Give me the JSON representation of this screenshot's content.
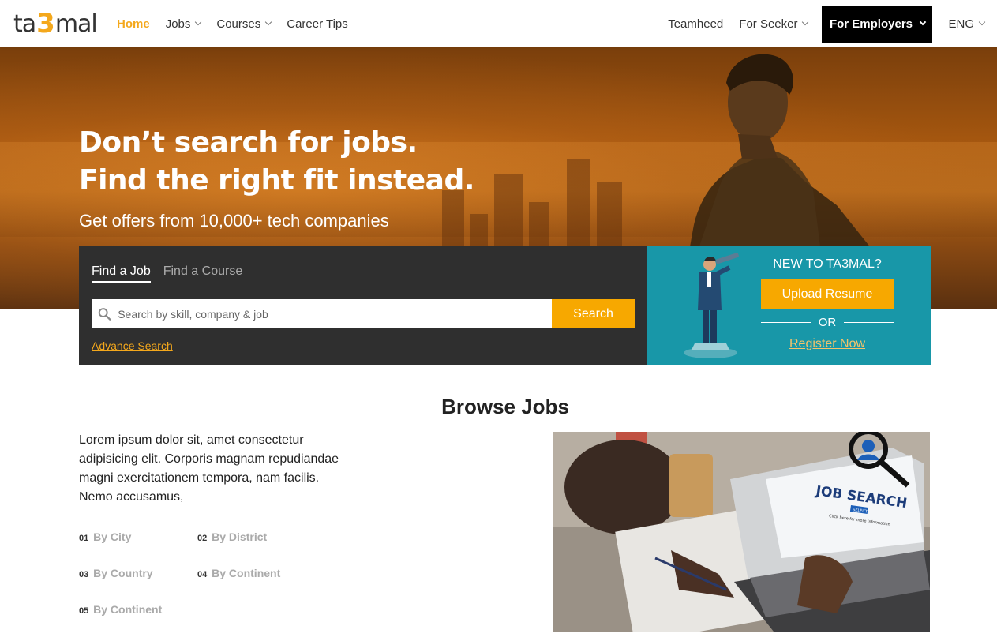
{
  "logo": {
    "left": "ta",
    "mid": "3",
    "right": "mal"
  },
  "nav": {
    "home": "Home",
    "jobs": "Jobs",
    "courses": "Courses",
    "career_tips": "Career Tips",
    "teamheed": "Teamheed",
    "for_seeker": "For Seeker",
    "for_employers": "For Employers",
    "lang": "ENG"
  },
  "hero": {
    "headline_1": "Don’t search for jobs.",
    "headline_2": "Find the right fit instead.",
    "subtitle": "Get offers from 10,000+ tech companies"
  },
  "search": {
    "tab_job": "Find a Job",
    "tab_course": "Find a Course",
    "placeholder": "Search by skill, company & job",
    "button": "Search",
    "advance": "Advance Search"
  },
  "signup": {
    "title": "NEW TO TA3MAL?",
    "upload": "Upload Resume",
    "or": "OR",
    "register": "Register Now"
  },
  "browse": {
    "title": "Browse Jobs",
    "description": "Lorem ipsum dolor sit, amet consectetur adipisicing elit. Corporis magnam repudiandae magni exercitationem tempora, nam facilis. Nemo accusamus,",
    "categories": [
      {
        "num": "01",
        "label": "By City"
      },
      {
        "num": "02",
        "label": "By District"
      },
      {
        "num": "03",
        "label": "By Country"
      },
      {
        "num": "04",
        "label": "By Continent"
      },
      {
        "num": "05",
        "label": "By Continent"
      }
    ],
    "photo_text_1": "JOB SEARCH",
    "photo_text_2": "SELECT",
    "photo_text_3": "Click here for more information"
  },
  "colors": {
    "accent": "#f7a800",
    "dark_panel": "#2f2f2f",
    "teal_panel": "#1897a8"
  }
}
